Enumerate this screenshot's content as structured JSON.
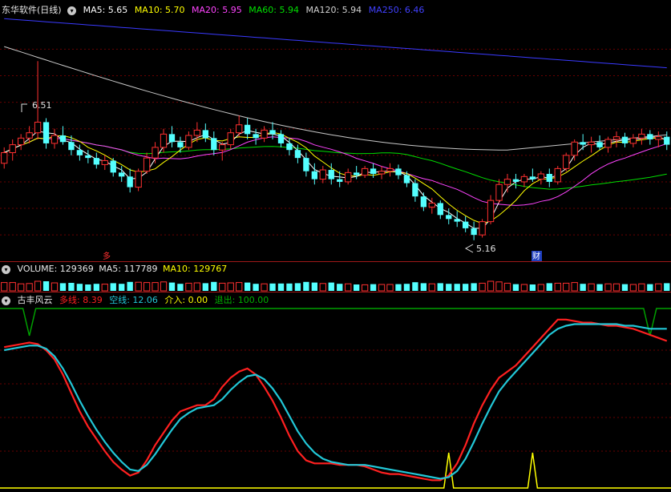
{
  "price_panel": {
    "header": {
      "title": "东华软件(日线)",
      "ma5": "MA5: 5.65",
      "ma10": "MA10: 5.70",
      "ma20": "MA20: 5.95",
      "ma60": "MA60: 5.94",
      "ma120": "MA120: 5.94",
      "ma250": "MA250: 6.46"
    },
    "high_label": "6.51",
    "low_label": "5.16",
    "markers": {
      "left": "多",
      "right": "财"
    },
    "colors": {
      "ma5": "#ffffff",
      "ma10": "#ffff00",
      "ma20": "#ff44ff",
      "ma60": "#00dd00",
      "ma120": "#c8c8c8",
      "ma250": "#3a3aff",
      "up": "#ff3030",
      "down": "#54ffff"
    }
  },
  "volume_panel": {
    "header": {
      "volume": "VOLUME: 129369",
      "ma5": "MA5: 117789",
      "ma10": "MA10: 129767"
    }
  },
  "indicator_panel": {
    "header": {
      "name": "古丰风云",
      "long": "多线: 8.39",
      "short": "空线: 12.06",
      "enter": "介入: 0.00",
      "exit": "退出: 100.00"
    }
  },
  "chart_data": [
    {
      "type": "candlestick",
      "title": "东华软件(日线)",
      "annotations": {
        "high": 6.51,
        "low": 5.16
      },
      "ma_latest": {
        "MA5": 5.65,
        "MA10": 5.7,
        "MA20": 5.95,
        "MA60": 5.94,
        "MA120": 5.94,
        "MA250": 6.46
      },
      "ohlc": [
        [
          5.74,
          5.86,
          5.7,
          5.82
        ],
        [
          5.82,
          5.92,
          5.76,
          5.88
        ],
        [
          5.88,
          5.96,
          5.84,
          5.93
        ],
        [
          5.93,
          6.02,
          5.89,
          5.97
        ],
        [
          5.97,
          6.51,
          5.92,
          6.05
        ],
        [
          6.05,
          6.08,
          5.85,
          5.89
        ],
        [
          5.89,
          6.0,
          5.85,
          5.95
        ],
        [
          5.95,
          6.02,
          5.88,
          5.9
        ],
        [
          5.9,
          5.95,
          5.8,
          5.84
        ],
        [
          5.84,
          5.88,
          5.76,
          5.8
        ],
        [
          5.8,
          5.84,
          5.74,
          5.78
        ],
        [
          5.78,
          5.82,
          5.7,
          5.73
        ],
        [
          5.73,
          5.8,
          5.69,
          5.76
        ],
        [
          5.76,
          5.78,
          5.64,
          5.67
        ],
        [
          5.67,
          5.72,
          5.6,
          5.64
        ],
        [
          5.64,
          5.7,
          5.52,
          5.56
        ],
        [
          5.56,
          5.7,
          5.53,
          5.68
        ],
        [
          5.68,
          5.82,
          5.66,
          5.78
        ],
        [
          5.78,
          5.9,
          5.74,
          5.86
        ],
        [
          5.86,
          6.0,
          5.82,
          5.96
        ],
        [
          5.96,
          6.02,
          5.86,
          5.9
        ],
        [
          5.9,
          5.94,
          5.82,
          5.86
        ],
        [
          5.86,
          5.98,
          5.84,
          5.95
        ],
        [
          5.95,
          6.05,
          5.9,
          5.99
        ],
        [
          5.99,
          6.04,
          5.9,
          5.93
        ],
        [
          5.93,
          5.98,
          5.8,
          5.84
        ],
        [
          5.84,
          5.9,
          5.76,
          5.88
        ],
        [
          5.88,
          6.0,
          5.85,
          5.97
        ],
        [
          5.97,
          6.1,
          5.94,
          6.03
        ],
        [
          6.03,
          6.08,
          5.92,
          5.96
        ],
        [
          5.96,
          6.0,
          5.88,
          5.93
        ],
        [
          5.93,
          6.02,
          5.9,
          5.99
        ],
        [
          5.99,
          6.05,
          5.92,
          5.96
        ],
        [
          5.96,
          5.99,
          5.86,
          5.89
        ],
        [
          5.89,
          5.93,
          5.8,
          5.84
        ],
        [
          5.84,
          5.88,
          5.74,
          5.78
        ],
        [
          5.78,
          5.82,
          5.64,
          5.68
        ],
        [
          5.68,
          5.74,
          5.58,
          5.62
        ],
        [
          5.62,
          5.72,
          5.59,
          5.69
        ],
        [
          5.69,
          5.74,
          5.58,
          5.62
        ],
        [
          5.62,
          5.68,
          5.56,
          5.6
        ],
        [
          5.6,
          5.7,
          5.58,
          5.67
        ],
        [
          5.67,
          5.72,
          5.62,
          5.65
        ],
        [
          5.65,
          5.72,
          5.63,
          5.7
        ],
        [
          5.7,
          5.74,
          5.63,
          5.66
        ],
        [
          5.66,
          5.72,
          5.62,
          5.68
        ],
        [
          5.68,
          5.74,
          5.64,
          5.7
        ],
        [
          5.7,
          5.73,
          5.62,
          5.65
        ],
        [
          5.65,
          5.68,
          5.56,
          5.59
        ],
        [
          5.59,
          5.62,
          5.45,
          5.49
        ],
        [
          5.49,
          5.52,
          5.38,
          5.41
        ],
        [
          5.41,
          5.48,
          5.36,
          5.44
        ],
        [
          5.44,
          5.46,
          5.32,
          5.35
        ],
        [
          5.35,
          5.4,
          5.28,
          5.32
        ],
        [
          5.32,
          5.38,
          5.26,
          5.3
        ],
        [
          5.3,
          5.34,
          5.22,
          5.25
        ],
        [
          5.25,
          5.3,
          5.16,
          5.2
        ],
        [
          5.2,
          5.32,
          5.18,
          5.3
        ],
        [
          5.3,
          5.5,
          5.28,
          5.46
        ],
        [
          5.46,
          5.62,
          5.44,
          5.58
        ],
        [
          5.58,
          5.66,
          5.52,
          5.62
        ],
        [
          5.62,
          5.66,
          5.55,
          5.6
        ],
        [
          5.6,
          5.66,
          5.56,
          5.64
        ],
        [
          5.64,
          5.7,
          5.6,
          5.62
        ],
        [
          5.62,
          5.68,
          5.58,
          5.66
        ],
        [
          5.66,
          5.7,
          5.56,
          5.6
        ],
        [
          5.6,
          5.72,
          5.58,
          5.7
        ],
        [
          5.7,
          5.82,
          5.68,
          5.8
        ],
        [
          5.8,
          5.92,
          5.76,
          5.9
        ],
        [
          5.9,
          5.96,
          5.84,
          5.88
        ],
        [
          5.88,
          5.94,
          5.82,
          5.9
        ],
        [
          5.9,
          5.95,
          5.84,
          5.86
        ],
        [
          5.86,
          5.94,
          5.82,
          5.92
        ],
        [
          5.92,
          5.98,
          5.86,
          5.94
        ],
        [
          5.94,
          5.97,
          5.86,
          5.89
        ],
        [
          5.89,
          5.96,
          5.86,
          5.93
        ],
        [
          5.93,
          6.0,
          5.88,
          5.96
        ],
        [
          5.96,
          5.99,
          5.88,
          5.92
        ],
        [
          5.92,
          5.98,
          5.86,
          5.94
        ],
        [
          5.94,
          5.98,
          5.84,
          5.88
        ]
      ]
    },
    {
      "type": "bar",
      "title": "VOLUME",
      "latest": {
        "VOLUME": 129369,
        "MA5": 117789,
        "MA10": 129767
      }
    },
    {
      "type": "line",
      "title": "古丰风云",
      "ylim": [
        0,
        100
      ],
      "latest": {
        "多线": 8.39,
        "空线": 12.06,
        "介入": 0.0,
        "退出": 100.0
      },
      "series": [
        {
          "name": "多线",
          "color": "#ff2020",
          "values": [
            90,
            91,
            92,
            93,
            92,
            88,
            82,
            72,
            60,
            48,
            38,
            30,
            22,
            15,
            10,
            6,
            8,
            16,
            26,
            34,
            42,
            48,
            50,
            52,
            52,
            56,
            64,
            70,
            74,
            76,
            72,
            64,
            55,
            44,
            32,
            22,
            16,
            14,
            14,
            14,
            13,
            13,
            13,
            12,
            10,
            8,
            7,
            7,
            6,
            5,
            4,
            3,
            3,
            6,
            14,
            26,
            40,
            52,
            62,
            70,
            74,
            78,
            84,
            90,
            96,
            102,
            108,
            108,
            107,
            106,
            106,
            105,
            104,
            104,
            103,
            102,
            100,
            98,
            96,
            94
          ]
        },
        {
          "name": "空线",
          "color": "#22c8d8",
          "values": [
            88,
            89,
            90,
            91,
            91,
            89,
            84,
            76,
            66,
            55,
            45,
            36,
            28,
            21,
            15,
            10,
            9,
            13,
            20,
            28,
            36,
            43,
            47,
            50,
            51,
            52,
            56,
            62,
            67,
            71,
            72,
            69,
            63,
            55,
            45,
            35,
            27,
            21,
            17,
            15,
            14,
            13,
            13,
            13,
            12,
            11,
            10,
            9,
            8,
            7,
            6,
            5,
            4,
            5,
            9,
            17,
            28,
            40,
            51,
            61,
            68,
            74,
            80,
            86,
            92,
            98,
            102,
            104,
            105,
            105,
            105,
            105,
            105,
            105,
            104,
            104,
            103,
            102,
            102,
            102
          ]
        }
      ],
      "signals": {
        "enter_at": [
          53,
          63
        ],
        "exit_at": [
          3,
          77
        ]
      }
    }
  ]
}
